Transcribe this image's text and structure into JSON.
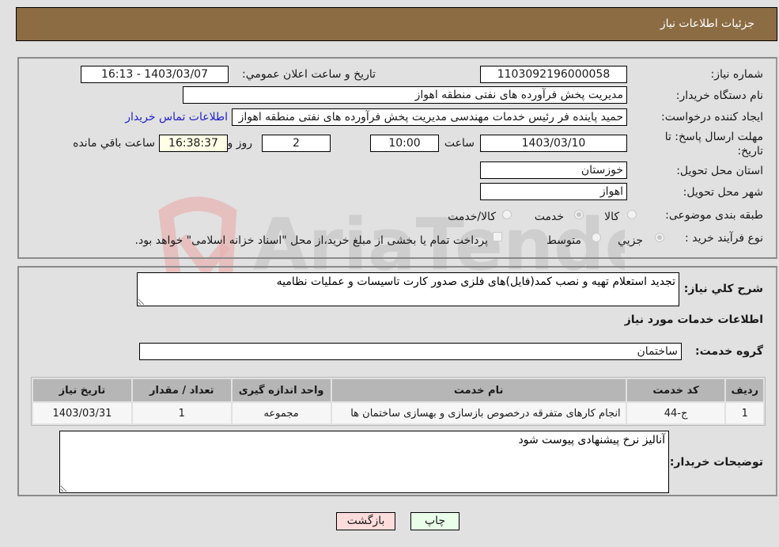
{
  "header": {
    "title": "جزئیات اطلاعات نیاز"
  },
  "need_info": {
    "need_number_label": "شماره نیاز:",
    "need_number": "1103092196000058",
    "announce_label": "تاریخ و ساعت اعلان عمومي:",
    "announce_value": "1403/03/07 - 16:13",
    "buyer_org_label": "نام دستگاه خریدار:",
    "buyer_org": "مدیریت پخش فرآورده های نفتی منطقه اهواز",
    "requester_label": "ایجاد کننده درخواست:",
    "requester": "حمید پاینده فر رئیس خدمات مهندسی مدیریت پخش فرآورده های نفتی منطقه اهواز",
    "contact_link": "اطلاعات تماس خریدار",
    "deadline_label": "مهلت ارسال پاسخ: تا تاریخ:",
    "deadline_date": "1403/03/10",
    "time_label": "ساعت",
    "deadline_time": "10:00",
    "days_value": "2",
    "days_label": "روز و",
    "remaining_time": "16:38:37",
    "remaining_label": "ساعت باقي مانده",
    "province_label": "استان محل تحویل:",
    "province": "خوزستان",
    "city_label": "شهر محل تحویل:",
    "city": "اهواز",
    "category_label": "طبقه بندی موضوعی:",
    "category_options": [
      {
        "label": "کالا",
        "checked": false
      },
      {
        "label": "خدمت",
        "checked": true
      },
      {
        "label": "کالا/خدمت",
        "checked": false
      }
    ],
    "process_label": "نوع فرآیند خرید :",
    "process_options": [
      {
        "label": "جزيي",
        "checked": true
      },
      {
        "label": "متوسط",
        "checked": false
      }
    ],
    "treasury_checkbox_label": "پرداخت تمام یا بخشی از مبلغ خرید،از محل \"اسناد خزانه اسلامی\" خواهد بود.",
    "treasury_checked": false
  },
  "details": {
    "description_label": "شرح کلي نياز:",
    "description": "تجدید استعلام تهیه و نصب کمد(فایل)های فلزی صدور کارت تاسیسات و عملیات نظامیه",
    "services_heading": "اطلاعات خدمات مورد نیاز",
    "service_group_label": "گروه خدمت:",
    "service_group": "ساختمان",
    "table": {
      "headers": [
        "ردیف",
        "کد خدمت",
        "نام خدمت",
        "واحد اندازه گیری",
        "تعداد / مقدار",
        "تاریخ نیاز"
      ],
      "rows": [
        [
          "1",
          "ج-44",
          "انجام کارهای متفرقه درخصوص بازسازی و بهسازی ساختمان ها",
          "مجموعه",
          "1",
          "1403/03/31"
        ]
      ]
    },
    "buyer_notes_label": "توضیحات خریدار:",
    "buyer_notes": "آنالیز نرخ پیشنهادی پیوست شود"
  },
  "buttons": {
    "print": "چاپ",
    "back": "بازگشت"
  },
  "colors": {
    "header_bg": "#8b6c43",
    "print_bg": "#eaffea",
    "back_bg": "#ffdcdc",
    "link": "#2222cc"
  }
}
